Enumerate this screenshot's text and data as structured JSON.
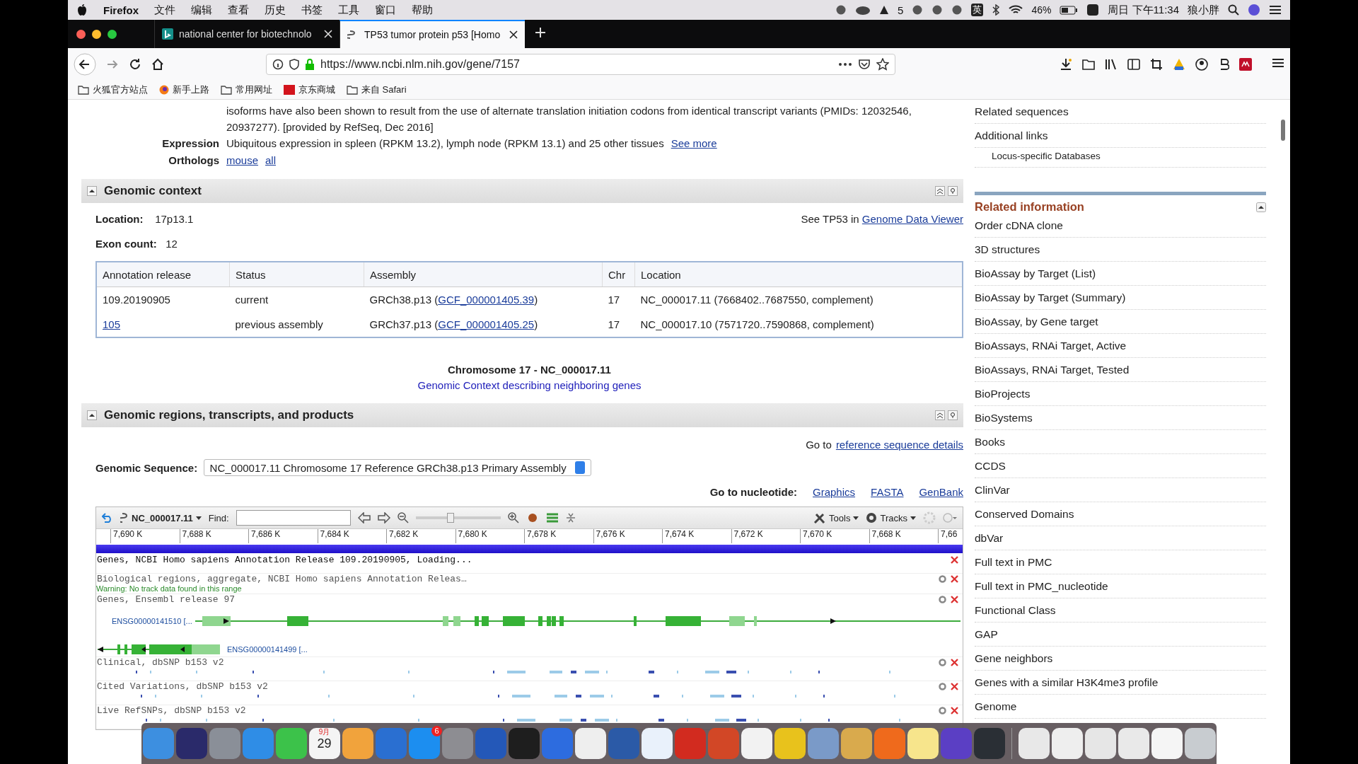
{
  "menubar": {
    "app": "Firefox",
    "menus": [
      "文件",
      "编辑",
      "查看",
      "历史",
      "书签",
      "工具",
      "窗口",
      "帮助"
    ],
    "adobe_count": "5",
    "ime": "英",
    "battery": "46%",
    "clock": "周日 下午11:34",
    "user": "狼小胖"
  },
  "tabs": [
    {
      "title": "national center for biotechnolo",
      "selected": false
    },
    {
      "title": "TP53 tumor protein p53 [Homo",
      "selected": true
    }
  ],
  "address_bar": {
    "url": "https://www.ncbi.nlm.nih.gov/gene/7157"
  },
  "bookmarks": [
    "火狐官方站点",
    "新手上路",
    "常用网址",
    "京东商城",
    "来自 Safari"
  ],
  "summary": {
    "text": "isoforms have also been shown to result from the use of alternate translation initiation codons from identical transcript variants (PMIDs: 12032546, 20937277). [provided by RefSeq, Dec 2016]",
    "expression_label": "Expression",
    "expression": "Ubiquitous expression in spleen (RPKM 13.2), lymph node (RPKM 13.1) and 25 other tissues",
    "expression_link": "See more",
    "orthologs_label": "Orthologs",
    "orthologs": [
      "mouse",
      "all"
    ]
  },
  "genomic_context": {
    "title": "Genomic context",
    "location_label": "Location:",
    "location": "17p13.1",
    "exon_label": "Exon count:",
    "exon_count": "12",
    "see_text": "See TP53 in",
    "see_link": "Genome Data Viewer",
    "table": {
      "columns": [
        "Annotation release",
        "Status",
        "Assembly",
        "Chr",
        "Location"
      ],
      "rows": [
        {
          "release": "109.20190905",
          "release_is_link": false,
          "status": "current",
          "assembly": "GRCh38.p13 (",
          "assembly_link": "GCF_000001405.39",
          "assembly_close": ")",
          "chr": "17",
          "location": "NC_000017.11 (7668402..7687550, complement)"
        },
        {
          "release": "105",
          "release_is_link": true,
          "status": "previous assembly",
          "assembly": "GRCh37.p13 (",
          "assembly_link": "GCF_000001405.25",
          "assembly_close": ")",
          "chr": "17",
          "location": "NC_000017.10 (7571720..7590868, complement)"
        }
      ]
    },
    "chromosome_title": "Chromosome 17 - NC_000017.11",
    "neighbors_link": "Genomic Context describing neighboring genes"
  },
  "genomic_regions": {
    "title": "Genomic regions, transcripts, and products",
    "goto_text": "Go to",
    "goto_link": "reference sequence details",
    "sequence_label": "Genomic Sequence:",
    "sequence_value": "NC_000017.11 Chromosome 17 Reference GRCh38.p13 Primary Assembly",
    "nucleotide_label": "Go to nucleotide:",
    "nucleotide_links": [
      "Graphics",
      "FASTA",
      "GenBank"
    ]
  },
  "viewer": {
    "sequence": "NC_000017.11",
    "zoom": {
      "level": 0.4
    },
    "find_label": "Find:",
    "tools": "Tools",
    "tracks_button": "Tracks",
    "ruler": [
      "7,690 K",
      "7,688 K",
      "7,686 K",
      "7,684 K",
      "7,682 K",
      "7,680 K",
      "7,678 K",
      "7,676 K",
      "7,674 K",
      "7,672 K",
      "7,670 K",
      "7,668 K",
      "7,66"
    ],
    "tracks": [
      {
        "kind": "loading",
        "title": "Genes, NCBI Homo sapiens Annotation Release 109.20190905, Loading..."
      },
      {
        "kind": "empty",
        "title": "Biological regions, aggregate, NCBI Homo sapiens Annotation Releas…",
        "warning": "Warning: No track data found in this range"
      },
      {
        "kind": "genes",
        "title": "Genes, Ensembl release 97",
        "genes": [
          "ENSG00000141510 [...",
          "ENSG00000141499 [..."
        ]
      },
      {
        "kind": "variants",
        "title": "Clinical, dbSNP b153 v2"
      },
      {
        "kind": "variants",
        "title": "Cited Variations, dbSNP b153 v2"
      },
      {
        "kind": "variants",
        "title": "Live RefSNPs, dbSNP b153 v2"
      }
    ]
  },
  "sidebar": {
    "links": [
      "Related sequences",
      "Additional links"
    ],
    "sublink": "Locus-specific Databases",
    "related_title": "Related information",
    "related": [
      "Order cDNA clone",
      "3D structures",
      "BioAssay by Target (List)",
      "BioAssay by Target (Summary)",
      "BioAssay, by Gene target",
      "BioAssays, RNAi Target, Active",
      "BioAssays, RNAi Target, Tested",
      "BioProjects",
      "BioSystems",
      "Books",
      "CCDS",
      "ClinVar",
      "Conserved Domains",
      "dbVar",
      "Full text in PMC",
      "Full text in PMC_nucleotide",
      "Functional Class",
      "GAP",
      "Gene neighbors",
      "Genes with a similar H3K4me3 profile",
      "Genome"
    ]
  },
  "dock": {
    "calendar_month": "9月",
    "calendar_day": "29",
    "appstore_badge": "6",
    "items": [
      {
        "color": "#3d8fe0"
      },
      {
        "color": "#2a2a6a"
      },
      {
        "color": "#8a8f98"
      },
      {
        "color": "#2f8de6"
      },
      {
        "color": "#3cc24a"
      },
      {
        "color": "#f4f4f4"
      },
      {
        "color": "#f1a33c"
      },
      {
        "color": "#2a6fd1"
      },
      {
        "color": "#1c8ef0"
      },
      {
        "color": "#8d8d92"
      },
      {
        "color": "#2458b8"
      },
      {
        "color": "#1e1e1e"
      },
      {
        "color": "#2d6cdf"
      },
      {
        "color": "#eeeeee"
      },
      {
        "color": "#2b5aa7"
      },
      {
        "color": "#e9f1fb"
      },
      {
        "color": "#d22b1f"
      },
      {
        "color": "#d24726"
      },
      {
        "color": "#f2f2f2"
      },
      {
        "color": "#e8c21c"
      },
      {
        "color": "#7a9ac8"
      },
      {
        "color": "#d9aa4d"
      },
      {
        "color": "#ef6a1c"
      },
      {
        "color": "#f7e58c"
      },
      {
        "color": "#5b3fc4"
      },
      {
        "color": "#2a2f35"
      },
      {
        "color": "#e8e8e8"
      },
      {
        "color": "#eeeeee"
      },
      {
        "color": "#e6e6e6"
      },
      {
        "color": "#e9e9e9"
      },
      {
        "color": "#f5f5f5"
      },
      {
        "color": "#c8ccd0"
      }
    ]
  }
}
